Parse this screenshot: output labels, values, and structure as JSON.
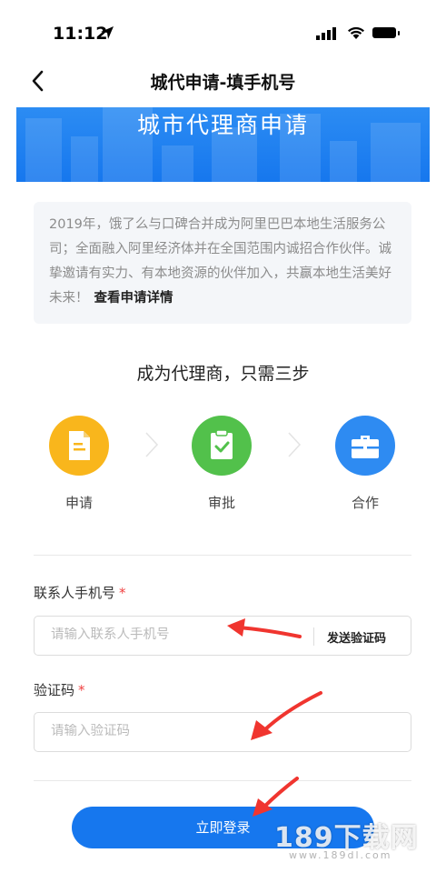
{
  "status_bar": {
    "time": "11:12"
  },
  "nav": {
    "back_icon": "chevron-left-icon",
    "title": "城代申请-填手机号"
  },
  "banner": {
    "title": "城市代理商申请"
  },
  "intro": {
    "text": "2019年，饿了么与口碑合并成为阿里巴巴本地生活服务公司；全面融入阿里经济体并在全国范围内诚招合作伙伴。诚挚邀请有实力、有本地资源的伙伴加入，共赢本地生活美好未来！",
    "link": "查看申请详情"
  },
  "steps": {
    "title": "成为代理商，只需三步",
    "items": [
      {
        "label": "申请",
        "icon": "document-icon",
        "color": "#f9b61c"
      },
      {
        "label": "审批",
        "icon": "clipboard-check-icon",
        "color": "#52c14b"
      },
      {
        "label": "合作",
        "icon": "briefcase-icon",
        "color": "#2e8bf2"
      }
    ]
  },
  "form": {
    "phone_label": "联系人手机号",
    "phone_placeholder": "请输入联系人手机号",
    "send_code": "发送验证码",
    "code_label": "验证码",
    "code_placeholder": "请输入验证码",
    "required_mark": "*"
  },
  "login_button": "立即登录",
  "watermark": {
    "text": "189下载网",
    "sub": "www.189dl.com"
  },
  "colors": {
    "primary": "#1677ee",
    "arrow": "#f0352f"
  }
}
